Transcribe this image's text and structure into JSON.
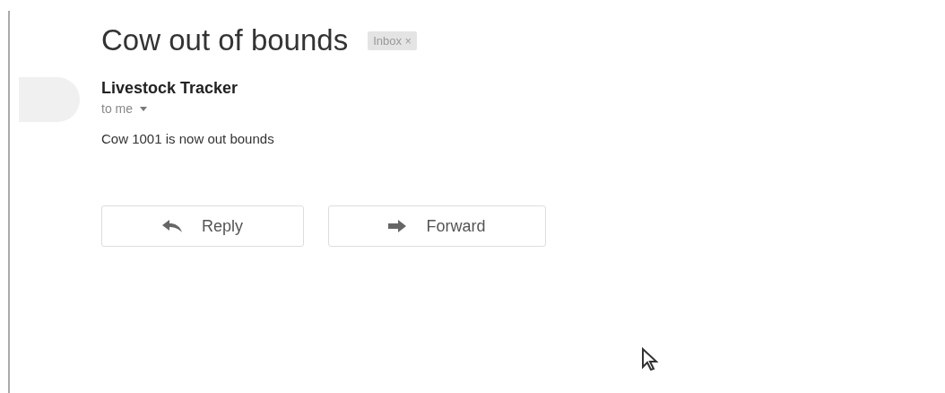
{
  "subject": "Cow out of bounds",
  "label": {
    "text": "Inbox",
    "close": "×"
  },
  "sender": {
    "name": "Livestock Tracker",
    "recipient": "to me"
  },
  "body": "Cow 1001 is now out bounds",
  "buttons": [
    {
      "kind": "reply",
      "label": "Reply"
    },
    {
      "kind": "forward",
      "label": "Forward"
    }
  ]
}
